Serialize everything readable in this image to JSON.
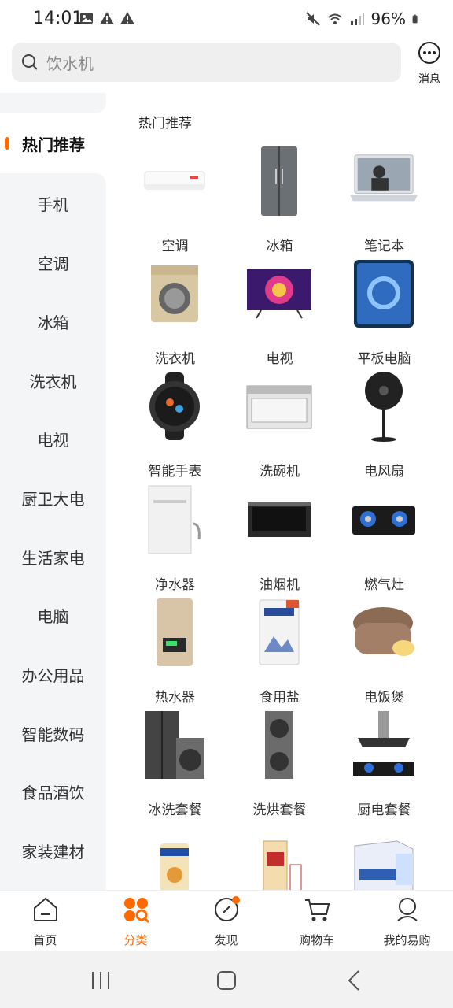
{
  "status": {
    "time": "14:01",
    "battery": "96%"
  },
  "search": {
    "placeholder": "饮水机"
  },
  "header": {
    "message_label": "消息"
  },
  "sidebar": {
    "active": "热门推荐",
    "items": [
      "手机",
      "空调",
      "冰箱",
      "洗衣机",
      "电视",
      "厨卫大电",
      "生活家电",
      "电脑",
      "办公用品",
      "智能数码",
      "食品酒饮",
      "家装建材"
    ]
  },
  "main": {
    "section_title": "热门推荐",
    "products": [
      {
        "label": "空调",
        "icon": "air-conditioner"
      },
      {
        "label": "冰箱",
        "icon": "refrigerator"
      },
      {
        "label": "笔记本",
        "icon": "laptop"
      },
      {
        "label": "洗衣机",
        "icon": "washing-machine"
      },
      {
        "label": "电视",
        "icon": "tv"
      },
      {
        "label": "平板电脑",
        "icon": "tablet"
      },
      {
        "label": "智能手表",
        "icon": "smart-watch"
      },
      {
        "label": "洗碗机",
        "icon": "dishwasher"
      },
      {
        "label": "电风扇",
        "icon": "fan"
      },
      {
        "label": "净水器",
        "icon": "water-purifier"
      },
      {
        "label": "油烟机",
        "icon": "range-hood"
      },
      {
        "label": "燃气灶",
        "icon": "gas-stove"
      },
      {
        "label": "热水器",
        "icon": "water-heater"
      },
      {
        "label": "食用盐",
        "icon": "salt"
      },
      {
        "label": "电饭煲",
        "icon": "rice-cooker"
      },
      {
        "label": "冰洗套餐",
        "icon": "fridge-washer-set"
      },
      {
        "label": "洗烘套餐",
        "icon": "washer-dryer-set"
      },
      {
        "label": "厨电套餐",
        "icon": "kitchen-set"
      },
      {
        "label": "",
        "icon": "milk-powder"
      },
      {
        "label": "",
        "icon": "liquor"
      },
      {
        "label": "",
        "icon": "milk-box"
      }
    ]
  },
  "tabs": [
    {
      "label": "首页",
      "icon": "home-icon"
    },
    {
      "label": "分类",
      "icon": "category-icon"
    },
    {
      "label": "发现",
      "icon": "discover-icon"
    },
    {
      "label": "购物车",
      "icon": "cart-icon"
    },
    {
      "label": "我的易购",
      "icon": "profile-icon"
    }
  ],
  "colors": {
    "accent": "#ff6a00",
    "sidebar_bg": "#f4f5f7"
  }
}
